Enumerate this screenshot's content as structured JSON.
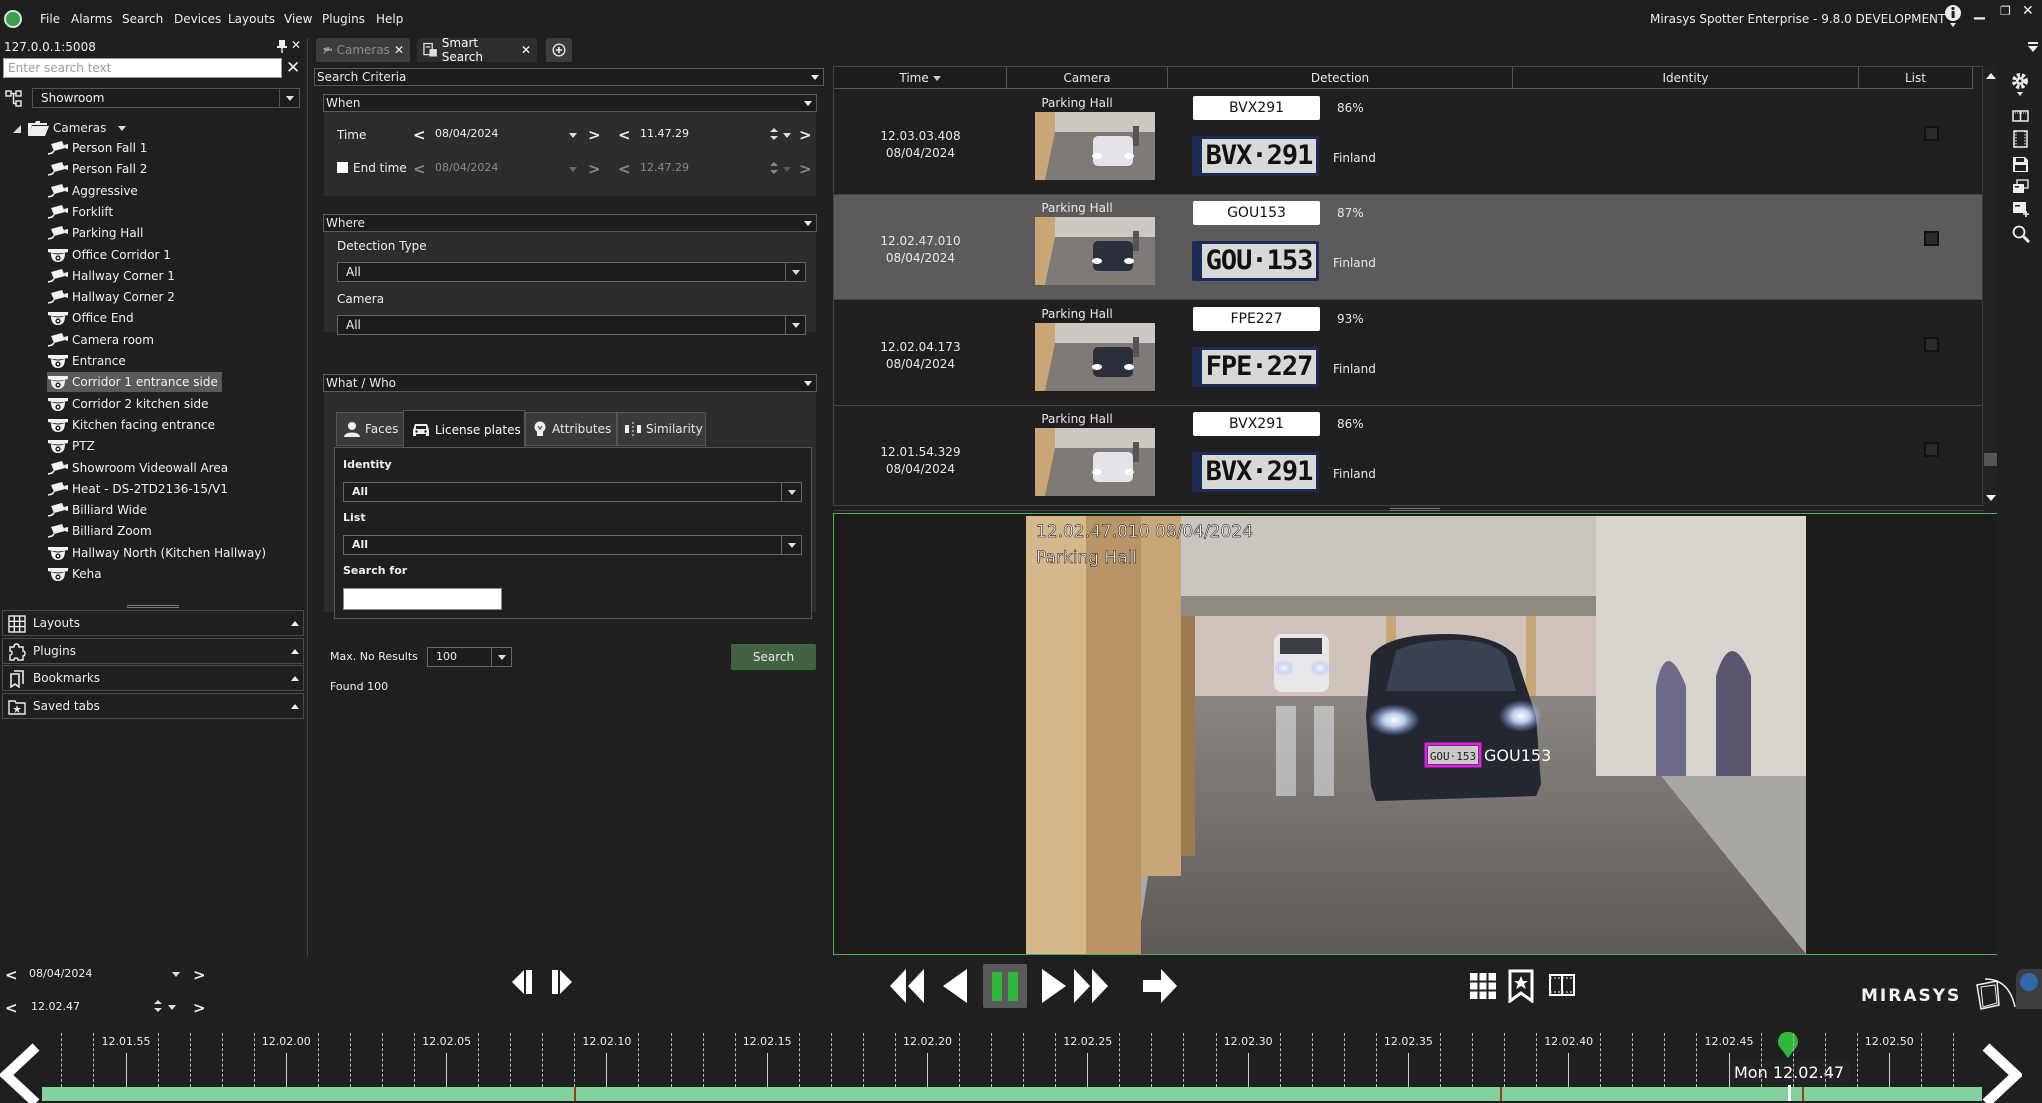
{
  "menubar": {
    "items": [
      "File",
      "Alarms",
      "Search",
      "Devices",
      "Layouts",
      "View",
      "Plugins",
      "Help"
    ],
    "title": "Mirasys Spotter Enterprise - 9.8.0 DEVELOPMENT"
  },
  "left_panel": {
    "server": "127.0.0.1:5008",
    "search_placeholder": "Enter search text",
    "search_value": "",
    "view_select": "Showroom",
    "root_label": "Cameras",
    "cameras": [
      {
        "name": "Person Fall 1",
        "icon": "bullet"
      },
      {
        "name": "Person Fall 2",
        "icon": "bullet"
      },
      {
        "name": "Aggressive",
        "icon": "bullet"
      },
      {
        "name": "Forklift",
        "icon": "bullet"
      },
      {
        "name": "Parking Hall",
        "icon": "bullet"
      },
      {
        "name": "Office Corridor 1",
        "icon": "dome"
      },
      {
        "name": "Hallway Corner 1",
        "icon": "bullet"
      },
      {
        "name": "Hallway Corner 2",
        "icon": "bullet"
      },
      {
        "name": "Office End",
        "icon": "dome"
      },
      {
        "name": "Camera room",
        "icon": "bullet"
      },
      {
        "name": "Entrance",
        "icon": "dome"
      },
      {
        "name": "Corridor 1 entrance side",
        "icon": "dome",
        "selected": true
      },
      {
        "name": "Corridor 2 kitchen side",
        "icon": "dome"
      },
      {
        "name": "Kitchen facing entrance",
        "icon": "dome"
      },
      {
        "name": "PTZ",
        "icon": "dome"
      },
      {
        "name": "Showroom Videowall Area",
        "icon": "bullet"
      },
      {
        "name": "Heat - DS-2TD2136-15/V1",
        "icon": "bullet"
      },
      {
        "name": "Billiard Wide",
        "icon": "bullet"
      },
      {
        "name": "Billiard Zoom",
        "icon": "bullet"
      },
      {
        "name": "Hallway North (Kitchen Hallway)",
        "icon": "dome"
      },
      {
        "name": "Keha",
        "icon": "dome"
      }
    ],
    "sections": [
      "Layouts",
      "Plugins",
      "Bookmarks",
      "Saved tabs"
    ]
  },
  "tabs": [
    {
      "label": "Cameras",
      "active": false
    },
    {
      "label": "Smart Search",
      "active": true
    }
  ],
  "criteria": {
    "title": "Search Criteria",
    "when": {
      "title": "When",
      "time_label": "Time",
      "time_date": "08/04/2024",
      "time_time": "11.47.29",
      "end_label": "End time",
      "end_checked": false,
      "end_date": "08/04/2024",
      "end_time": "12.47.29"
    },
    "where": {
      "title": "Where",
      "detection_type_label": "Detection Type",
      "detection_type_value": "All",
      "camera_label": "Camera",
      "camera_value": "All"
    },
    "what": {
      "title": "What / Who",
      "subtabs": [
        "Faces",
        "License plates",
        "Attributes",
        "Similarity"
      ],
      "active_subtab": "License plates",
      "identity_label": "Identity",
      "identity_value": "All",
      "list_label": "List",
      "list_value": "All",
      "search_for_label": "Search for",
      "search_for_value": ""
    },
    "max_results_label": "Max. No Results",
    "max_results_value": "100",
    "search_button": "Search",
    "found": "Found 100"
  },
  "results": {
    "columns": [
      "Time",
      "Camera",
      "Detection",
      "Identity",
      "List"
    ],
    "rows": [
      {
        "time": "12.03.03.408",
        "date": "08/04/2024",
        "camera": "Parking Hall",
        "plate": "BVX291",
        "plate_img": "BVX·291",
        "confidence": "86%",
        "country": "Finland",
        "selected": false,
        "car": "white"
      },
      {
        "time": "12.02.47.010",
        "date": "08/04/2024",
        "camera": "Parking Hall",
        "plate": "GOU153",
        "plate_img": "GOU·153",
        "confidence": "87%",
        "country": "Finland",
        "selected": true,
        "car": "dark"
      },
      {
        "time": "12.02.04.173",
        "date": "08/04/2024",
        "camera": "Parking Hall",
        "plate": "FPE227",
        "plate_img": "FPE·227",
        "confidence": "93%",
        "country": "Finland",
        "selected": false,
        "car": "dark"
      },
      {
        "time": "12.01.54.329",
        "date": "08/04/2024",
        "camera": "Parking Hall",
        "plate": "BVX291",
        "plate_img": "BVX·291",
        "confidence": "86%",
        "country": "Finland",
        "selected": false,
        "car": "white"
      }
    ]
  },
  "player": {
    "overlay_time": "12.02.47.010  08/04/2024",
    "overlay_camera": "Parking Hall",
    "detection_label": "GOU153",
    "plate_in_frame": "GOU·153",
    "bbox_color": "#e020e0"
  },
  "bottom": {
    "date": "08/04/2024",
    "time": "12.02.47",
    "brand": "MIRASYS",
    "timeline_ticks": [
      "12.01.55",
      "12.02.00",
      "12.02.05",
      "12.02.10",
      "12.02.15",
      "12.02.20",
      "12.02.25",
      "12.02.30",
      "12.02.35",
      "12.02.40",
      "12.02.45",
      "12.02.50"
    ],
    "cursor_label": "Mon 12.02.47",
    "recording_color": "#82d19b",
    "marker_color": "#2fb83a"
  }
}
